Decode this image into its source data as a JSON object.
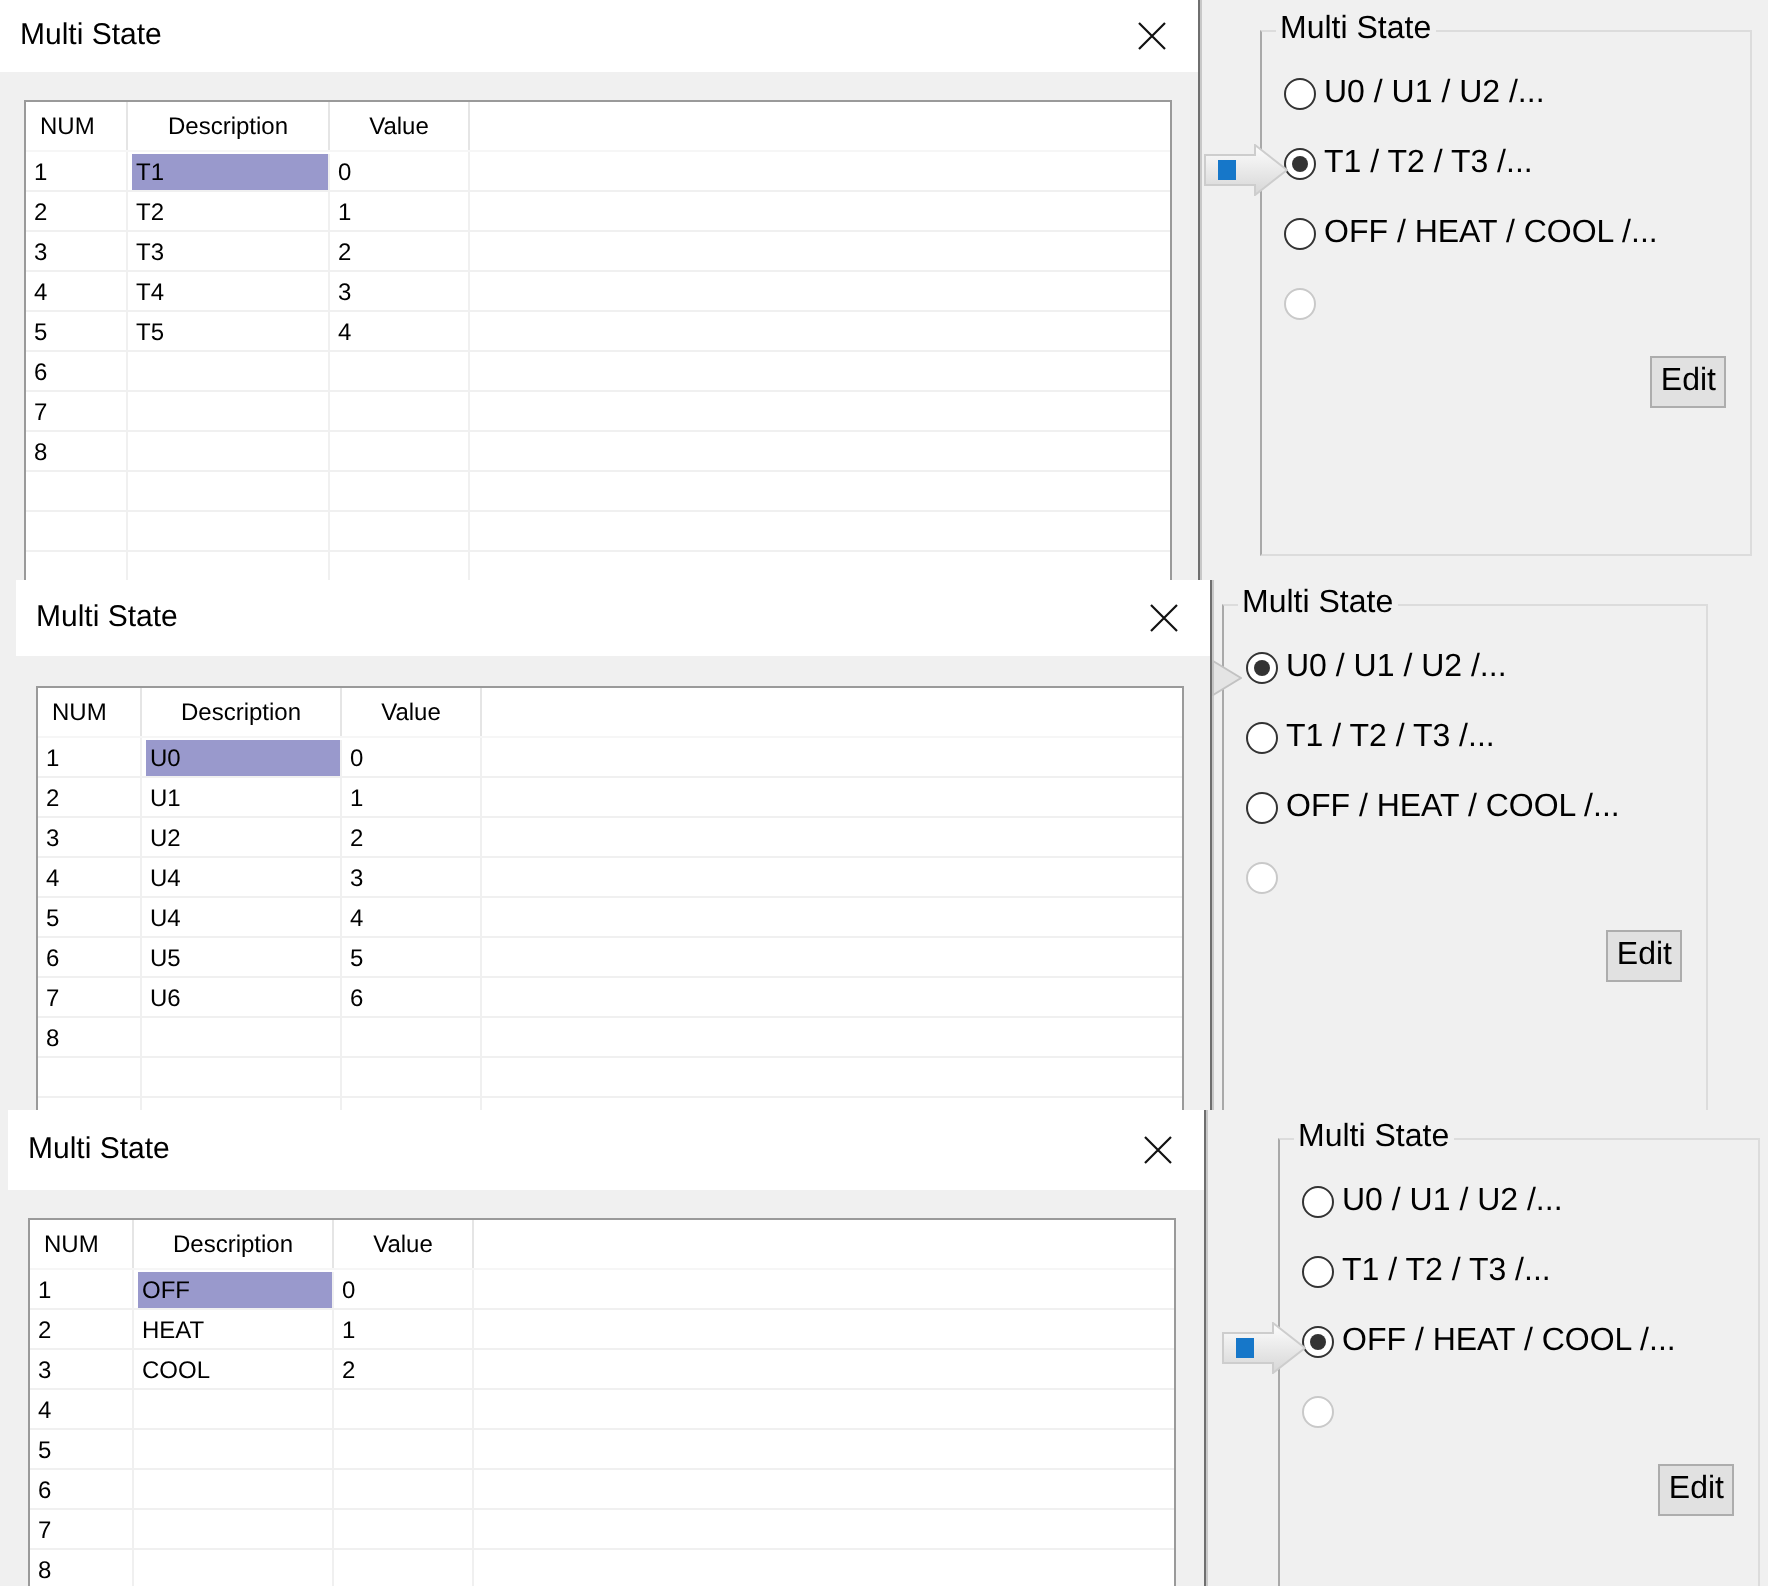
{
  "panels": [
    {
      "dialog": {
        "title": "Multi State",
        "table": {
          "columns": [
            "NUM",
            "Description",
            "Value"
          ],
          "rows": [
            {
              "num": "1",
              "description": "T1",
              "value": "0",
              "selected": true
            },
            {
              "num": "2",
              "description": "T2",
              "value": "1",
              "selected": false
            },
            {
              "num": "3",
              "description": "T3",
              "value": "2",
              "selected": false
            },
            {
              "num": "4",
              "description": "T4",
              "value": "3",
              "selected": false
            },
            {
              "num": "5",
              "description": "T5",
              "value": "4",
              "selected": false
            },
            {
              "num": "6",
              "selected": false
            },
            {
              "num": "7",
              "selected": false
            },
            {
              "num": "8",
              "selected": false
            }
          ]
        }
      },
      "group": {
        "title": "Multi State",
        "radios": [
          {
            "label": "U0 / U1 / U2 /...",
            "selected": false,
            "disabled": false
          },
          {
            "label": "T1 / T2 / T3 /...",
            "selected": true,
            "disabled": false
          },
          {
            "label": "OFF / HEAT / COOL /...",
            "selected": false,
            "disabled": false
          },
          {
            "selected": false,
            "disabled": true
          }
        ],
        "button": "Edit"
      },
      "pointer_arrow": true,
      "arrow_covered": false
    },
    {
      "dialog": {
        "title": "Multi State",
        "table": {
          "columns": [
            "NUM",
            "Description",
            "Value"
          ],
          "rows": [
            {
              "num": "1",
              "description": "U0",
              "value": "0",
              "selected": true
            },
            {
              "num": "2",
              "description": "U1",
              "value": "1",
              "selected": false
            },
            {
              "num": "3",
              "description": "U2",
              "value": "2",
              "selected": false
            },
            {
              "num": "4",
              "description": "U4",
              "value": "3",
              "selected": false
            },
            {
              "num": "5",
              "description": "U4",
              "value": "4",
              "selected": false
            },
            {
              "num": "6",
              "description": "U5",
              "value": "5",
              "selected": false
            },
            {
              "num": "7",
              "description": "U6",
              "value": "6",
              "selected": false
            },
            {
              "num": "8",
              "selected": false
            }
          ]
        }
      },
      "group": {
        "title": "Multi State",
        "radios": [
          {
            "label": "U0 / U1 / U2 /...",
            "selected": true,
            "disabled": false
          },
          {
            "label": "T1 / T2 / T3 /...",
            "selected": false,
            "disabled": false
          },
          {
            "label": "OFF / HEAT / COOL /...",
            "selected": false,
            "disabled": false
          },
          {
            "selected": false,
            "disabled": true
          }
        ],
        "button": "Edit"
      },
      "pointer_arrow": true,
      "arrow_covered": true
    },
    {
      "dialog": {
        "title": "Multi State",
        "table": {
          "columns": [
            "NUM",
            "Description",
            "Value"
          ],
          "rows": [
            {
              "num": "1",
              "description": "OFF",
              "value": "0",
              "selected": true
            },
            {
              "num": "2",
              "description": "HEAT",
              "value": "1",
              "selected": false
            },
            {
              "num": "3",
              "description": "COOL",
              "value": "2",
              "selected": false
            },
            {
              "num": "4",
              "selected": false
            },
            {
              "num": "5",
              "selected": false
            },
            {
              "num": "6",
              "selected": false
            },
            {
              "num": "7",
              "selected": false
            },
            {
              "num": "8",
              "selected": false
            }
          ]
        }
      },
      "group": {
        "title": "Multi State",
        "radios": [
          {
            "label": "U0 / U1 / U2 /...",
            "selected": false,
            "disabled": false
          },
          {
            "label": "T1 / T2 / T3 /...",
            "selected": false,
            "disabled": false
          },
          {
            "label": "OFF / HEAT / COOL /...",
            "selected": true,
            "disabled": false
          },
          {
            "selected": false,
            "disabled": true
          }
        ],
        "button": "Edit"
      },
      "pointer_arrow": true,
      "arrow_covered": false
    }
  ]
}
